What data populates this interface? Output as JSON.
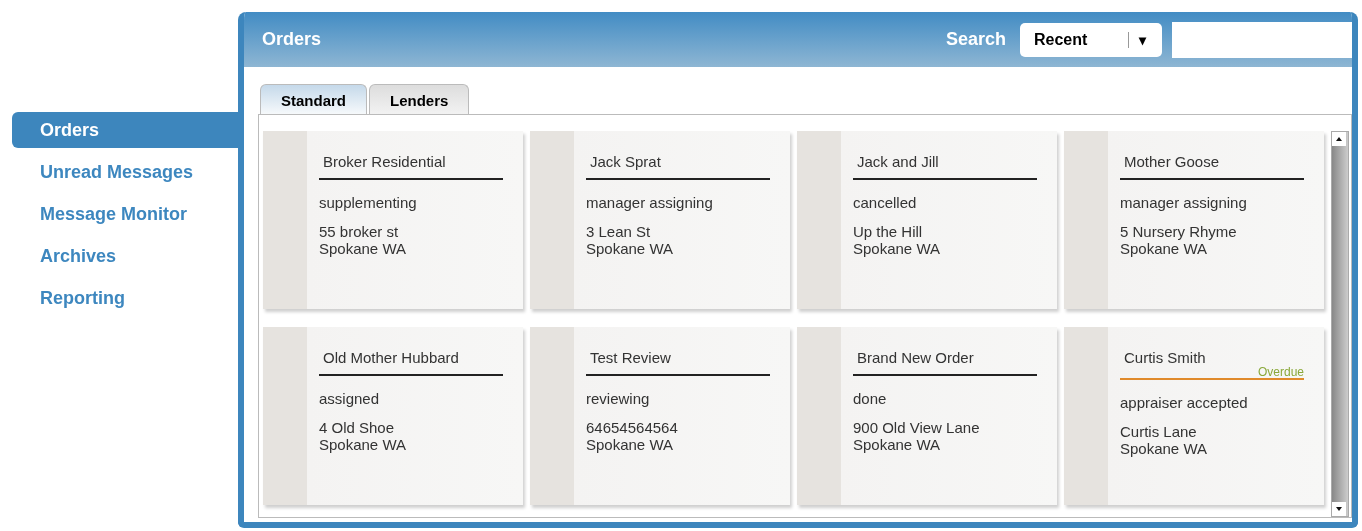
{
  "sidebar": {
    "items": [
      {
        "label": "Orders",
        "selected": true
      },
      {
        "label": "Unread Messages",
        "selected": false
      },
      {
        "label": "Message Monitor",
        "selected": false
      },
      {
        "label": "Archives",
        "selected": false
      },
      {
        "label": "Reporting",
        "selected": false
      }
    ]
  },
  "panel": {
    "title": "Orders",
    "search_label": "Search",
    "search_scope": "Recent",
    "dropdown_arrow": "▾"
  },
  "tabs": [
    {
      "label": "Standard",
      "selected": true
    },
    {
      "label": "Lenders",
      "selected": false
    }
  ],
  "orders": [
    {
      "name": "Broker Residential",
      "status": "supplementing",
      "address": "55 broker st",
      "city": "Spokane WA"
    },
    {
      "name": "Jack Sprat",
      "status": "manager assigning",
      "address": "3 Lean St",
      "city": "Spokane WA"
    },
    {
      "name": "Jack and Jill",
      "status": "cancelled",
      "address": "Up the Hill",
      "city": "Spokane WA"
    },
    {
      "name": "Mother Goose",
      "status": "manager assigning",
      "address": "5 Nursery Rhyme",
      "city": "Spokane WA"
    },
    {
      "name": "Old Mother Hubbard",
      "status": "assigned",
      "address": "4 Old Shoe",
      "city": "Spokane WA"
    },
    {
      "name": "Test Review",
      "status": "reviewing",
      "address": "64654564564",
      "city": "Spokane WA"
    },
    {
      "name": "Brand New Order",
      "status": "done",
      "address": "900 Old View Lane",
      "city": "Spokane WA"
    },
    {
      "name": "Curtis Smith",
      "flag": "Overdue",
      "status": "appraiser accepted",
      "address": "Curtis Lane",
      "city": "Spokane WA"
    }
  ]
}
